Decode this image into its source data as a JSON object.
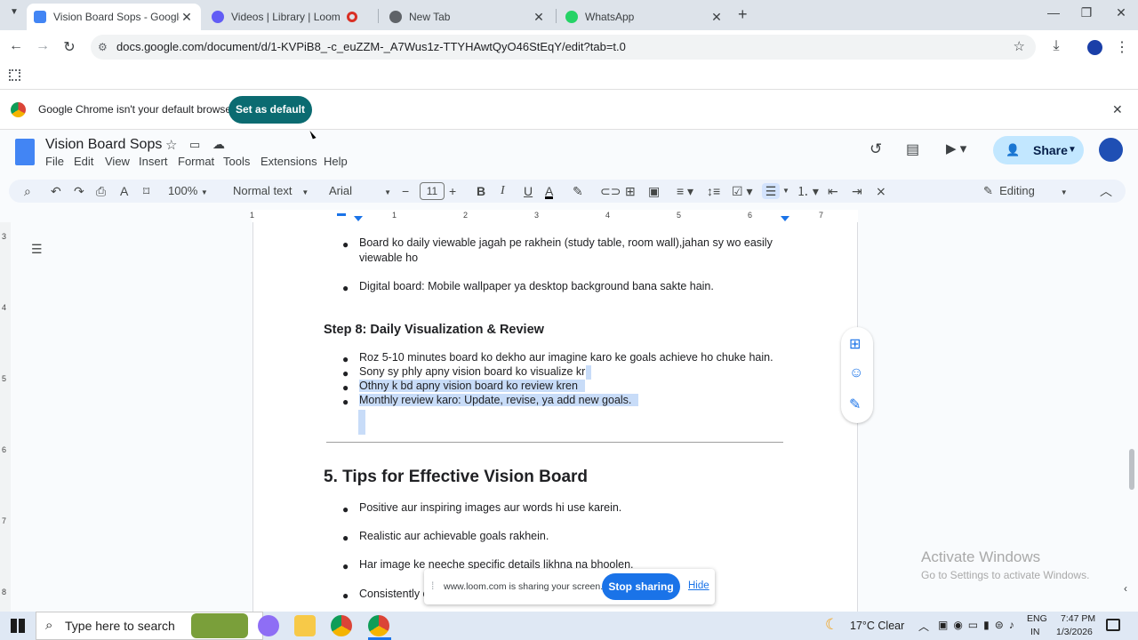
{
  "tabs": [
    {
      "title": "Vision Board Sops - Google Do",
      "close": "✕"
    },
    {
      "title": "Videos | Library | Loom",
      "close": ""
    },
    {
      "title": "New Tab",
      "close": "✕"
    },
    {
      "title": "WhatsApp",
      "close": "✕"
    }
  ],
  "new_tab": "+",
  "window_controls": {
    "minimize": "—",
    "maximize": "❐",
    "close": "✕"
  },
  "url": "docs.google.com/document/d/1-KVPiB8_-c_euZZM-_A7Wus1z-TTYHAwtQyO46StEqY/edit?tab=t.0",
  "infobar": {
    "message": "Google Chrome isn't your default browser",
    "button": "Set as default"
  },
  "doc": {
    "title": "Vision Board Sops",
    "menu": [
      "File",
      "Edit",
      "View",
      "Insert",
      "Format",
      "Tools",
      "Extensions",
      "Help"
    ],
    "share": "Share"
  },
  "format_bar": {
    "zoom": "100%",
    "style": "Normal text",
    "font": "Arial",
    "size": "11",
    "mode": "Editing"
  },
  "ruler_numbers": [
    "1",
    "1",
    "2",
    "3",
    "4",
    "5",
    "6",
    "7"
  ],
  "vruler_numbers": [
    "3",
    "4",
    "5",
    "6",
    "7",
    "8"
  ],
  "content": {
    "bullets_top": [
      "Board ko daily viewable jagah pe rakhein (study table, room wall),jahan sy wo easily",
      "viewable ho",
      "Digital board: Mobile wallpaper ya desktop background bana sakte hain."
    ],
    "step8_heading": "Step 8: Daily Visualization & Review",
    "step8_bullets": [
      "Roz 5-10 minutes board ko dekho aur imagine karo ke goals achieve ho chuke hain.",
      "Sony sy phly apny vision board ko visualize kru",
      "Othny k bd apny vision board ko review kren",
      "Monthly review karo: Update, revise, ya add new goals."
    ],
    "tips_heading": "5. Tips for Effective Vision Board",
    "tips_bullets": [
      "Positive aur inspiring images aur words hi use karein.",
      "Realistic aur achievable goals rakhein.",
      "Har image ke neeche specific details likhna na bhoolen.",
      "Consistently c"
    ]
  },
  "loom": {
    "message": "www.loom.com is sharing your screen.",
    "stop": "Stop sharing",
    "hide": "Hide"
  },
  "watermark": {
    "title": "Activate Windows",
    "subtitle": "Go to Settings to activate Windows."
  },
  "taskbar": {
    "search_placeholder": "Type here to search",
    "weather": "17°C  Clear",
    "lang1": "ENG",
    "lang2": "IN",
    "time": "7:47 PM",
    "date": "1/3/2026"
  },
  "colors": {
    "accent": "#0b6b71",
    "selection": "#c8dcf8",
    "share": "#c2e7ff",
    "docs_blue": "#4285f4"
  }
}
